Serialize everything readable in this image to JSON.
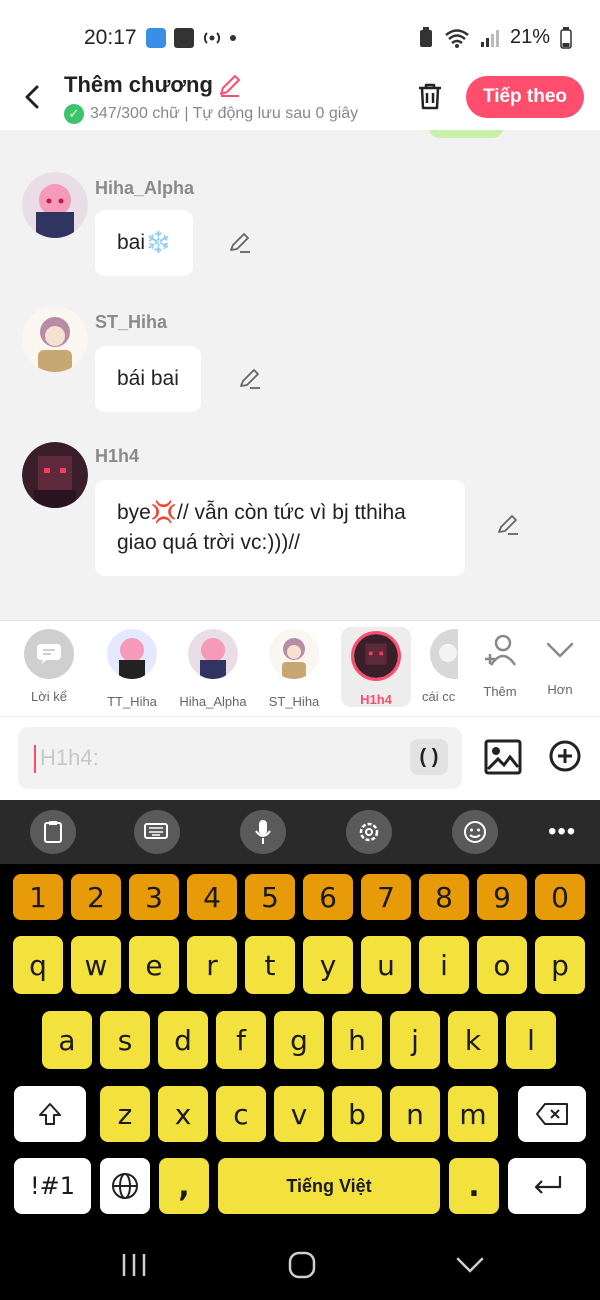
{
  "status": {
    "time": "20:17",
    "battery": "21%"
  },
  "header": {
    "title": "Thêm chương",
    "subtitle": "347/300 chữ | Tự động lưu sau 0 giây",
    "next_label": "Tiếp theo"
  },
  "messages": [
    {
      "name": "Hiha_Alpha",
      "text": "bai❄️"
    },
    {
      "name": "ST_Hiha",
      "text": "bái bai"
    },
    {
      "name": "H1h4",
      "text": "bye💢// vẫn còn tức vì bj tthiha giao quá trời vc:)))//"
    }
  ],
  "characters": [
    {
      "label": "Lời kể"
    },
    {
      "label": "TT_Hiha"
    },
    {
      "label": "Hiha_Alpha"
    },
    {
      "label": "ST_Hiha"
    },
    {
      "label": "H1h4"
    },
    {
      "label": "cái cc"
    }
  ],
  "more_label": "Thêm",
  "less_label": "Hơn",
  "input": {
    "placeholder": "H1h4:",
    "paren_label": "( )"
  },
  "keyboard": {
    "numbers": [
      "1",
      "2",
      "3",
      "4",
      "5",
      "6",
      "7",
      "8",
      "9",
      "0"
    ],
    "row1": [
      "q",
      "w",
      "e",
      "r",
      "t",
      "y",
      "u",
      "i",
      "o",
      "p"
    ],
    "row2": [
      "a",
      "s",
      "d",
      "f",
      "g",
      "h",
      "j",
      "k",
      "l"
    ],
    "row3": [
      "z",
      "x",
      "c",
      "v",
      "b",
      "n",
      "m"
    ],
    "symbols_label": "!#1",
    "comma_label": ",",
    "space_label": "Tiếng Việt",
    "period_label": "."
  },
  "colors": {
    "accent": "#ff4d6d",
    "num_key": "#e89b09",
    "letter_key": "#f3e13e"
  }
}
